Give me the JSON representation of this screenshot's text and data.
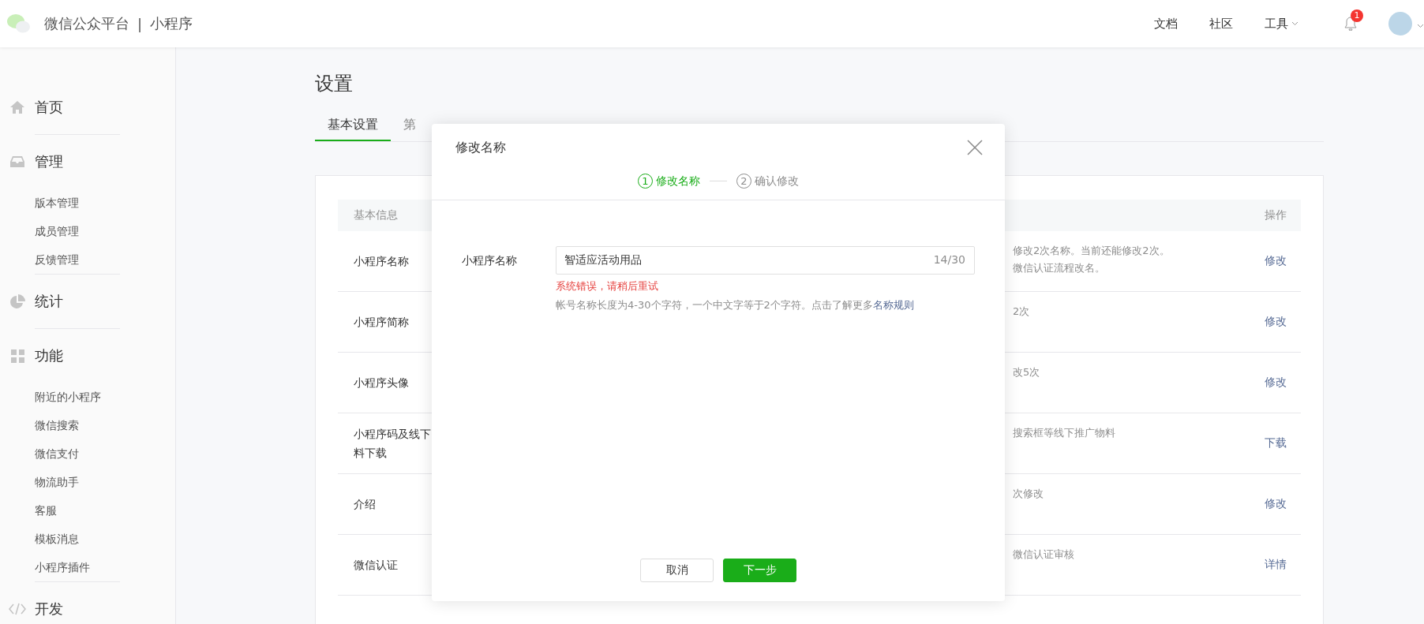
{
  "header": {
    "brand": "微信公众平台",
    "separator": "|",
    "product": "小程序",
    "links": [
      {
        "label": "文档",
        "dropdown": false
      },
      {
        "label": "社区",
        "dropdown": false
      },
      {
        "label": "工具",
        "dropdown": true
      }
    ],
    "notifications": {
      "count": "1"
    }
  },
  "sidebar": {
    "groups": [
      {
        "kind": "home",
        "title": "首页"
      },
      {
        "kind": "inbox",
        "title": "管理",
        "items": [
          "版本管理",
          "成员管理",
          "反馈管理"
        ]
      },
      {
        "kind": "stats",
        "title": "统计"
      },
      {
        "kind": "grid",
        "title": "功能",
        "items": [
          "附近的小程序",
          "微信搜索",
          "微信支付",
          "物流助手",
          "客服",
          "模板消息",
          "小程序插件"
        ]
      },
      {
        "kind": "code",
        "title": "开发"
      }
    ]
  },
  "page": {
    "title": "设置",
    "tabs": [
      {
        "label": "基本设置",
        "selected": true
      },
      {
        "label": "第",
        "selected": false
      }
    ]
  },
  "table": {
    "columns": [
      "基本信息",
      "操作"
    ],
    "rows": [
      {
        "name": [
          "小程序名称"
        ],
        "description": [
          "修改2次名称。当前还能修改2次。",
          "微信认证流程改名。"
        ],
        "action": "修改"
      },
      {
        "name": [
          "小程序简称"
        ],
        "description": [
          "2次"
        ],
        "action": "修改"
      },
      {
        "name": [
          "小程序头像"
        ],
        "description": [
          "改5次"
        ],
        "action": "修改"
      },
      {
        "name": [
          "小程序码及线下",
          "料下载"
        ],
        "description": [
          "搜索框等线下推广物料"
        ],
        "action": "下载"
      },
      {
        "name": [
          "介绍"
        ],
        "description": [
          "次修改"
        ],
        "action": "修改"
      },
      {
        "name": [
          "微信认证"
        ],
        "description": [
          "微信认证审核"
        ],
        "action": "详情"
      }
    ]
  },
  "dialog": {
    "title": "修改名称",
    "steps": [
      {
        "number": "1",
        "label": "修改名称",
        "selected": true
      },
      {
        "number": "2",
        "label": "确认修改",
        "selected": false
      }
    ],
    "form": {
      "label": "小程序名称",
      "value": "智适应活动用品",
      "counter": "14/30",
      "error": "系统错误，请稍后重试",
      "hint": "帐号名称长度为4-30个字符，一个中文字等于2个字符。点击了解更多",
      "hint_link": "名称规则"
    },
    "buttons": [
      {
        "label": "取消",
        "kind": "secondary"
      },
      {
        "label": "下一步",
        "kind": "primary"
      }
    ]
  }
}
